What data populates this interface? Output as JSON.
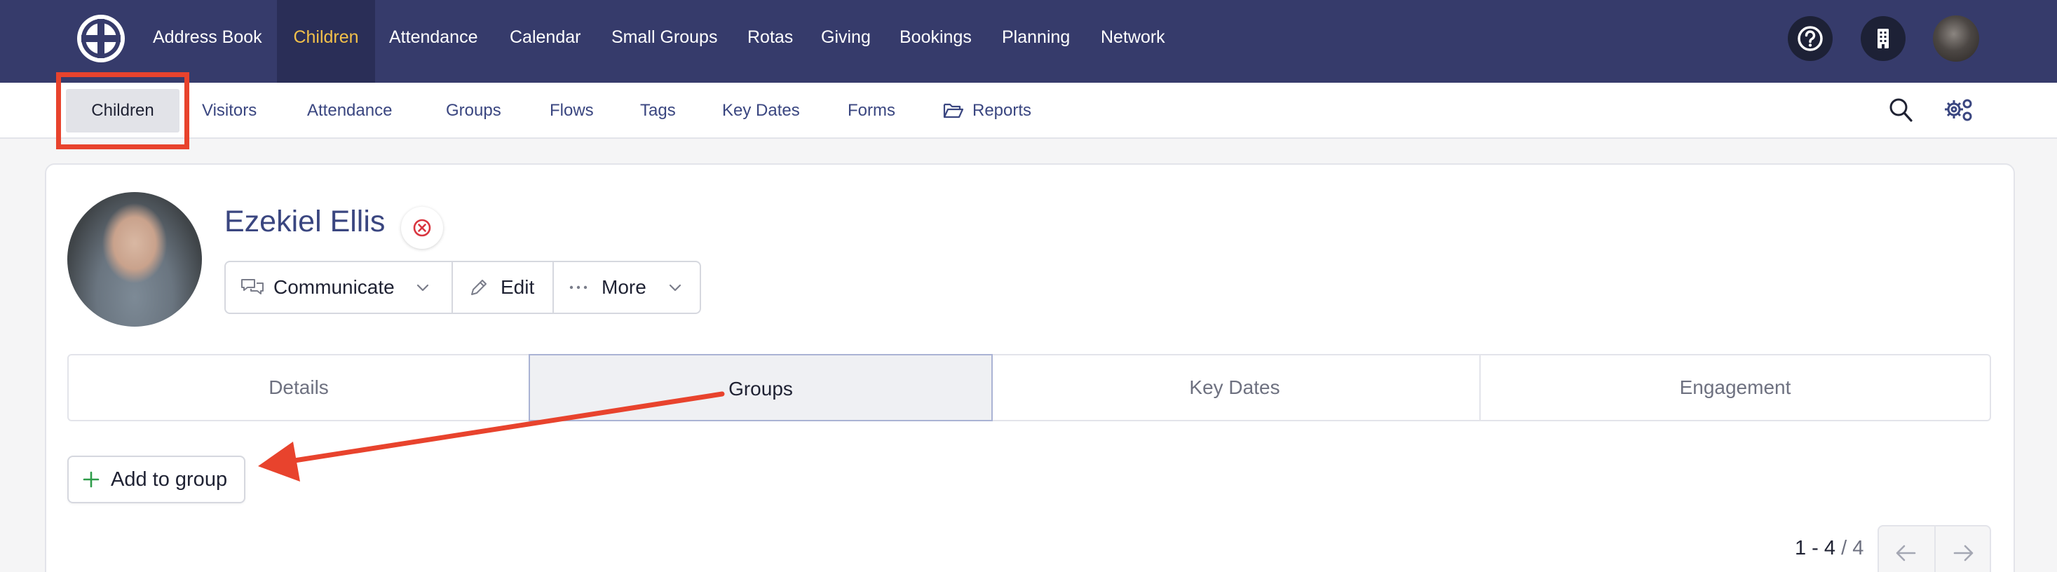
{
  "topnav": {
    "logo_icon": "church-cross-logo-icon",
    "items": [
      {
        "label": "Address Book"
      },
      {
        "label": "Children"
      },
      {
        "label": "Attendance"
      },
      {
        "label": "Calendar"
      },
      {
        "label": "Small Groups"
      },
      {
        "label": "Rotas"
      },
      {
        "label": "Giving"
      },
      {
        "label": "Bookings"
      },
      {
        "label": "Planning"
      },
      {
        "label": "Network"
      }
    ],
    "active_item": "Children",
    "right_icons": [
      "help-icon",
      "building-icon",
      "user-avatar"
    ]
  },
  "subnav": {
    "items": [
      {
        "label": "Children"
      },
      {
        "label": "Visitors"
      },
      {
        "label": "Attendance"
      },
      {
        "label": "Groups"
      },
      {
        "label": "Flows"
      },
      {
        "label": "Tags"
      },
      {
        "label": "Key Dates"
      },
      {
        "label": "Forms"
      },
      {
        "label": "Reports",
        "icon": "folder-open-icon"
      }
    ],
    "active_item": "Children",
    "right_icons": [
      "search-icon",
      "settings-gears-icon"
    ]
  },
  "profile": {
    "name": "Ezekiel Ellis",
    "status_icon": "remove-circle-icon",
    "actions": {
      "communicate": "Communicate",
      "edit": "Edit",
      "more": "More"
    }
  },
  "tabs": [
    {
      "label": "Details"
    },
    {
      "label": "Groups"
    },
    {
      "label": "Key Dates"
    },
    {
      "label": "Engagement"
    }
  ],
  "active_tab": "Groups",
  "groups": {
    "add_button_label": "Add to group"
  },
  "pagination": {
    "range": "1 - 4",
    "total": "4"
  },
  "colors": {
    "topnav_bg": "#363b6b",
    "active_nav_text": "#f2c04a",
    "link_text": "#3a4680",
    "annotation_red": "#e8432d",
    "add_icon_green": "#2e9c4a"
  }
}
